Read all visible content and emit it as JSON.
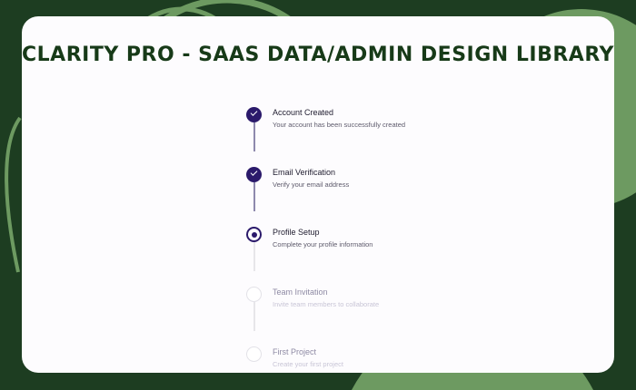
{
  "title": "CLARITY PRO - SAAS DATA/ADMIN DESIGN LIBRARY",
  "colors": {
    "background": "#1d3d21",
    "accent": "#2b1a6b",
    "arc": "#6d9a61"
  },
  "steps": [
    {
      "label": "Account Created",
      "description": "Your account has been successfully created",
      "status": "completed"
    },
    {
      "label": "Email Verification",
      "description": "Verify your email address",
      "status": "completed"
    },
    {
      "label": "Profile Setup",
      "description": "Complete your profile information",
      "status": "current"
    },
    {
      "label": "Team Invitation",
      "description": "Invite team members to collaborate",
      "status": "pending"
    },
    {
      "label": "First Project",
      "description": "Create your first project",
      "status": "pending"
    }
  ]
}
